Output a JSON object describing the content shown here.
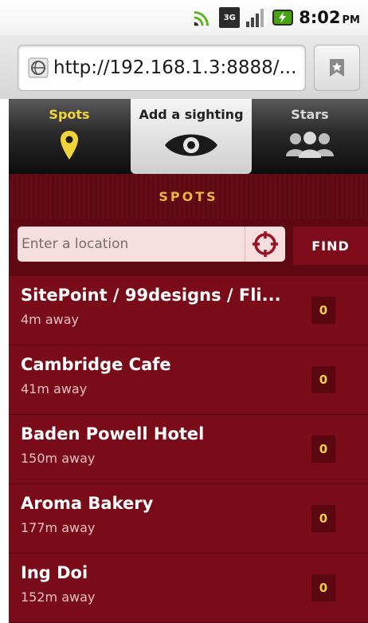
{
  "status_bar": {
    "time": "8:02",
    "ampm": "PM",
    "network": "3G"
  },
  "browser": {
    "url": "http://192.168.1.3:8888/..."
  },
  "tabs": [
    {
      "label": "Spots",
      "icon": "map-pin-icon",
      "state": "inactive"
    },
    {
      "label": "Add a sighting",
      "icon": "eye-icon",
      "state": "active"
    },
    {
      "label": "Stars",
      "icon": "people-icon",
      "state": "inactive"
    }
  ],
  "header": {
    "title": "SPOTS"
  },
  "search": {
    "placeholder": "Enter a location",
    "value": "",
    "find_label": "FIND"
  },
  "spots": [
    {
      "name": "SitePoint / 99designs / Fli...",
      "distance": "4m away",
      "count": "0"
    },
    {
      "name": "Cambridge Cafe",
      "distance": "41m away",
      "count": "0"
    },
    {
      "name": "Baden Powell Hotel",
      "distance": "150m away",
      "count": "0"
    },
    {
      "name": "Aroma Bakery",
      "distance": "177m away",
      "count": "0"
    },
    {
      "name": "Ing Doi",
      "distance": "152m away",
      "count": "0"
    }
  ],
  "colors": {
    "brand_red": "#7a0b19",
    "accent_gold": "#f3d33a",
    "header_gold": "#e9b63e"
  }
}
